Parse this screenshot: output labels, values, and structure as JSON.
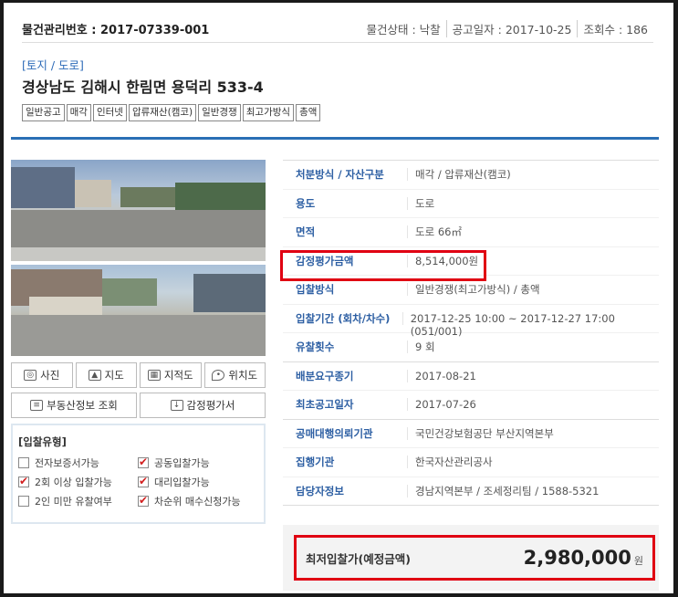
{
  "header": {
    "item_no": "물건관리번호 : 2017-07339-001",
    "status": "물건상태 : 낙찰",
    "notice_date": "공고일자 : 2017-10-25",
    "views": "조회수 : 186"
  },
  "property": {
    "category": "[토지 / 도로]",
    "address": "경상남도 김해시 한림면 용덕리 533-4"
  },
  "tags": [
    "일반공고",
    "매각",
    "인터넷",
    "압류재산(캠코)",
    "일반경쟁",
    "최고가방식",
    "총액"
  ],
  "photo_caption": "",
  "buttons": {
    "photo": "사진",
    "map": "지도",
    "cadastral": "지적도",
    "location": "위치도",
    "realestate": "부동산정보 조회",
    "appraisal": "감정평가서"
  },
  "icons": {
    "photo": "camera-icon",
    "map": "map-icon",
    "cadastral": "grid-icon",
    "location": "pin-icon",
    "realestate": "document-icon",
    "appraisal": "download-icon"
  },
  "bid_type": {
    "title": "[입찰유형]",
    "options": [
      {
        "label": "전자보증서가능",
        "checked": false
      },
      {
        "label": "공동입찰가능",
        "checked": true
      },
      {
        "label": "2회 이상 입찰가능",
        "checked": true
      },
      {
        "label": "대리입찰가능",
        "checked": true
      },
      {
        "label": "2인 미만 유찰여부",
        "checked": false
      },
      {
        "label": "차순위 매수신청가능",
        "checked": true
      }
    ]
  },
  "info": [
    {
      "key": "처분방식 / 자산구분",
      "value": "매각 / 압류재산(캠코)"
    },
    {
      "key": "용도",
      "value": "도로"
    },
    {
      "key": "면적",
      "value": "도로 66㎡"
    },
    {
      "key": "감정평가금액",
      "value": "8,514,000원"
    },
    {
      "key": "입찰방식",
      "value": "일반경쟁(최고가방식) / 총액"
    },
    {
      "key": "입찰기간 (회차/차수)",
      "value": "2017-12-25 10:00 ~ 2017-12-27 17:00 (051/001)"
    },
    {
      "key": "유찰횟수",
      "value": "9 회"
    },
    {
      "key": "배분요구종기",
      "value": "2017-08-21"
    },
    {
      "key": "최초공고일자",
      "value": "2017-07-26"
    },
    {
      "key": "공매대행의뢰기관",
      "value": "국민건강보험공단 부산지역본부"
    },
    {
      "key": "집행기관",
      "value": "한국자산관리공사"
    },
    {
      "key": "담당자정보",
      "value": "경남지역본부 / 조세정리팀 / 1588-5321"
    }
  ],
  "min_bid": {
    "label": "최저입찰가(예정금액)",
    "amount": "2,980,000",
    "unit": "원"
  },
  "colors": {
    "accent": "#2a6fb5",
    "highlight": "#e00012",
    "check": "#d21f1f"
  }
}
